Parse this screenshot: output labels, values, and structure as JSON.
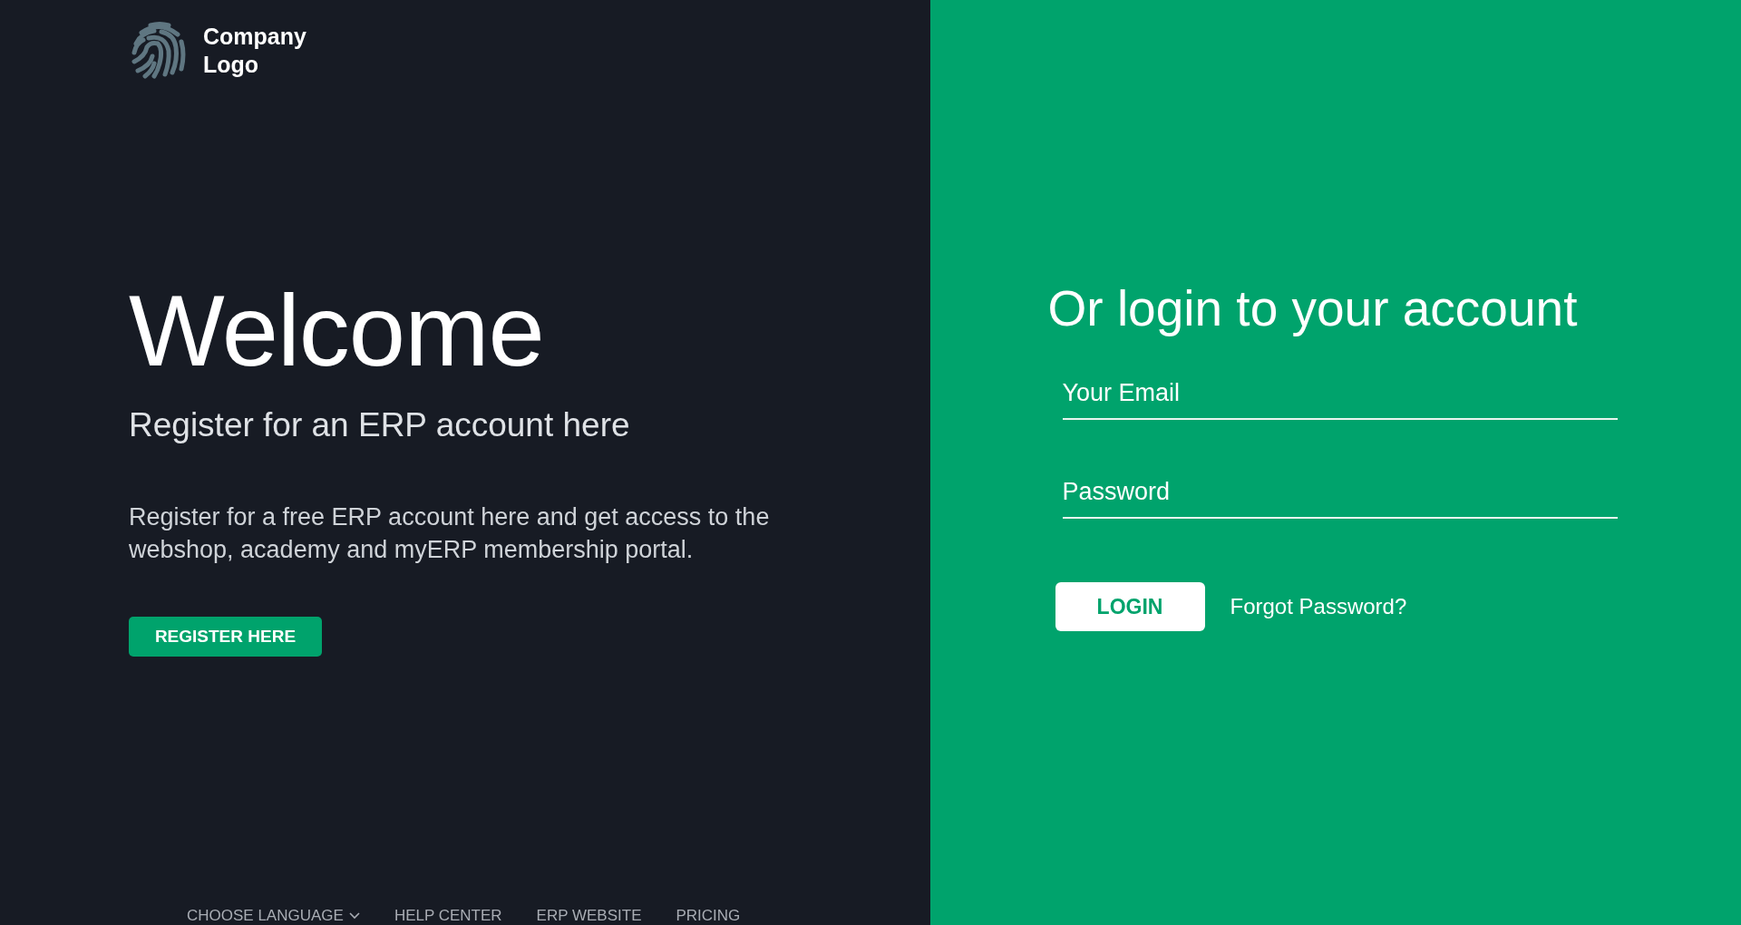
{
  "logo": {
    "text_line_1": "Company",
    "text_line_2": "Logo"
  },
  "welcome": {
    "title": "Welcome",
    "subtitle": "Register for an ERP account here",
    "description": "Register for a free ERP account here and get access to the webshop, academy and myERP membership portal.",
    "button": "REGISTER HERE"
  },
  "footer_links": [
    {
      "label": "CHOOSE LANGUAGE",
      "kind": "dropdown"
    },
    {
      "label": "HELP CENTER",
      "kind": "link"
    },
    {
      "label": "ERP WEBSITE",
      "kind": "link"
    },
    {
      "label": "PRICING",
      "kind": "link"
    }
  ],
  "login": {
    "title": "Or login to your account",
    "email": {
      "placeholder": "Your Email"
    },
    "password": {
      "placeholder": "Password"
    },
    "button": "LOGIN",
    "forgot_link": "Forgot Password?"
  }
}
